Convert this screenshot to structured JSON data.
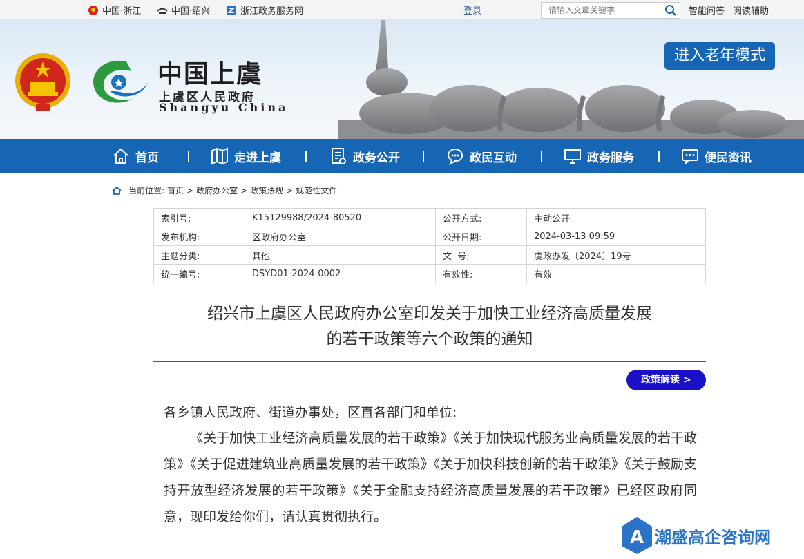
{
  "topbar": {
    "links": [
      {
        "label": "中国·浙江",
        "icon": "emblem-icon"
      },
      {
        "label": "中国·绍兴",
        "icon": "shaoxing-icon"
      },
      {
        "label": "浙江政务服务网",
        "icon": "zjzw-icon"
      }
    ],
    "login": "登录",
    "search_placeholder": "请输入文章关键字",
    "tools": [
      "智能问答",
      "阅读辅助"
    ]
  },
  "header": {
    "logo_title": "中国上虞",
    "logo_subtitle": "上虞区人民政府",
    "logo_english": "Shangyu China",
    "elder_mode": "进入老年模式"
  },
  "nav": [
    {
      "label": "首页",
      "icon": "home-icon"
    },
    {
      "label": "走进上虞",
      "icon": "map-icon"
    },
    {
      "label": "政务公开",
      "icon": "document-icon"
    },
    {
      "label": "政民互动",
      "icon": "chat-icon"
    },
    {
      "label": "政务服务",
      "icon": "monitor-icon"
    },
    {
      "label": "便民资讯",
      "icon": "message-icon"
    }
  ],
  "breadcrumb": {
    "prefix": "当前位置:",
    "items": [
      "首页",
      "政府办公室",
      "政策法规",
      "规范性文件"
    ],
    "separator": ">"
  },
  "meta": [
    [
      "索引号:",
      "K15129988/2024-80520",
      "公开方式:",
      "主动公开"
    ],
    [
      "发布机构:",
      "区政府办公室",
      "公开日期:",
      "2024-03-13 09:59"
    ],
    [
      "主题分类:",
      "其他",
      "文  号:",
      "虞政办发〔2024〕19号"
    ],
    [
      "统一编号:",
      "DSYD01-2024-0002",
      "有效性:",
      "有效"
    ]
  ],
  "document": {
    "title_line1": "绍兴市上虞区人民政府办公室印发关于加快工业经济高质量发展",
    "title_line2": "的若干政策等六个政策的通知",
    "interpretation_button": "政策解读 >",
    "salutation": "各乡镇人民政府、街道办事处，区直各部门和单位:",
    "paragraph": "《关于加快工业经济高质量发展的若干政策》《关于加快现代服务业高质量发展的若干政策》《关于促进建筑业高质量发展的若干政策》《关于加快科技创新的若干政策》《关于鼓励支持开放型经济发展的若干政策》《关于金融支持经济高质量发展的若干政策》已经区政府同意，现印发给你们，请认真贯彻执行。"
  },
  "watermark": "潮盛高企咨询网",
  "colors": {
    "nav_blue": "#1765b5",
    "interp_blue": "#1a10c8",
    "watermark_blue": "#2a73c9"
  }
}
